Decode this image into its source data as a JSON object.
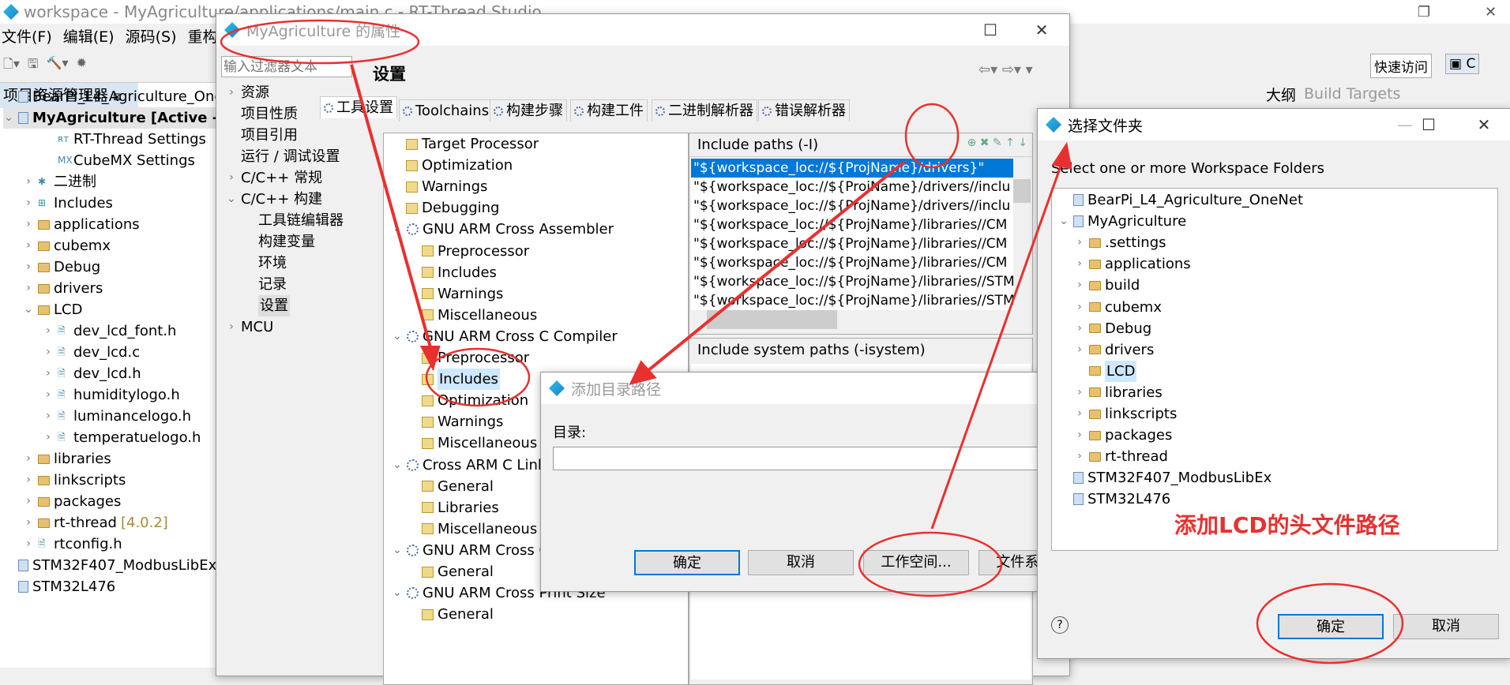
{
  "main_window": {
    "title": "workspace - MyAgriculture/applications/main.c - RT-Thread Studio",
    "menu": [
      "文件(F)",
      "编辑(E)",
      "源码(S)",
      "重构(T)"
    ],
    "quick_access": "快速访问",
    "explorer_tab": "项目资源管理器",
    "outline_tab": "大纲",
    "build_targets_tab": "Build Targets",
    "explorer_items": [
      {
        "label": "BearPi_L4_Agriculture_OneNet",
        "indent": 0,
        "icon": "project",
        "chev": ""
      },
      {
        "label": "MyAgriculture     [Active - ",
        "indent": 0,
        "icon": "project",
        "chev": "v",
        "bold": true
      },
      {
        "label": "RT-Thread Settings",
        "indent": 2,
        "icon": "rt",
        "chev": ""
      },
      {
        "label": "CubeMX Settings",
        "indent": 2,
        "icon": "mx",
        "chev": ""
      },
      {
        "label": "二进制",
        "indent": 1,
        "icon": "binary",
        "chev": ">"
      },
      {
        "label": "Includes",
        "indent": 1,
        "icon": "includes",
        "chev": ">"
      },
      {
        "label": "applications",
        "indent": 1,
        "icon": "folder",
        "chev": ">"
      },
      {
        "label": "cubemx",
        "indent": 1,
        "icon": "folder",
        "chev": ">"
      },
      {
        "label": "Debug",
        "indent": 1,
        "icon": "folder",
        "chev": ">"
      },
      {
        "label": "drivers",
        "indent": 1,
        "icon": "folder",
        "chev": ">"
      },
      {
        "label": "LCD",
        "indent": 1,
        "icon": "folder",
        "chev": "v"
      },
      {
        "label": "dev_lcd_font.h",
        "indent": 2,
        "icon": "file",
        "chev": ">"
      },
      {
        "label": "dev_lcd.c",
        "indent": 2,
        "icon": "file",
        "chev": ">"
      },
      {
        "label": "dev_lcd.h",
        "indent": 2,
        "icon": "file",
        "chev": ">"
      },
      {
        "label": "humiditylogo.h",
        "indent": 2,
        "icon": "file",
        "chev": ">"
      },
      {
        "label": "luminancelogo.h",
        "indent": 2,
        "icon": "file",
        "chev": ">"
      },
      {
        "label": "temperatuelogo.h",
        "indent": 2,
        "icon": "file",
        "chev": ">"
      },
      {
        "label": "libraries",
        "indent": 1,
        "icon": "folder",
        "chev": ">"
      },
      {
        "label": "linkscripts",
        "indent": 1,
        "icon": "folder",
        "chev": ">"
      },
      {
        "label": "packages",
        "indent": 1,
        "icon": "folder",
        "chev": ">"
      },
      {
        "label": "rt-thread",
        "indent": 1,
        "icon": "folder",
        "chev": ">",
        "suffix": "[4.0.2]"
      },
      {
        "label": "rtconfig.h",
        "indent": 1,
        "icon": "file",
        "chev": ">"
      },
      {
        "label": "STM32F407_ModbusLibEx",
        "indent": 0,
        "icon": "project",
        "chev": ""
      },
      {
        "label": "STM32L476",
        "indent": 0,
        "icon": "project",
        "chev": ""
      }
    ]
  },
  "properties_dialog": {
    "title": "MyAgriculture 的属性",
    "filter_placeholder": "输入过滤器文本",
    "heading": "设置",
    "nav": [
      {
        "label": "资源",
        "indent": 0,
        "chev": ">"
      },
      {
        "label": "项目性质",
        "indent": 0,
        "chev": ""
      },
      {
        "label": "项目引用",
        "indent": 0,
        "chev": ""
      },
      {
        "label": "运行 / 调试设置",
        "indent": 0,
        "chev": ""
      },
      {
        "label": "C/C++ 常规",
        "indent": 0,
        "chev": ">"
      },
      {
        "label": "C/C++ 构建",
        "indent": 0,
        "chev": "v"
      },
      {
        "label": "工具链编辑器",
        "indent": 1,
        "chev": ""
      },
      {
        "label": "构建变量",
        "indent": 1,
        "chev": ""
      },
      {
        "label": "环境",
        "indent": 1,
        "chev": ""
      },
      {
        "label": "记录",
        "indent": 1,
        "chev": ""
      },
      {
        "label": "设置",
        "indent": 1,
        "chev": "",
        "selected": true
      },
      {
        "label": "MCU",
        "indent": 0,
        "chev": ">"
      }
    ],
    "tabs": [
      "工具设置",
      "Toolchains",
      "构建步骤",
      "构建工件",
      "二进制解析器",
      "错误解析器"
    ],
    "tool_tree": [
      {
        "label": "Target Processor",
        "indent": 1,
        "icon": "tool"
      },
      {
        "label": "Optimization",
        "indent": 1,
        "icon": "tool"
      },
      {
        "label": "Warnings",
        "indent": 1,
        "icon": "tool"
      },
      {
        "label": "Debugging",
        "indent": 1,
        "icon": "tool"
      },
      {
        "label": "GNU ARM Cross Assembler",
        "indent": 0,
        "icon": "gear"
      },
      {
        "label": "Preprocessor",
        "indent": 2,
        "icon": "tool"
      },
      {
        "label": "Includes",
        "indent": 2,
        "icon": "tool"
      },
      {
        "label": "Warnings",
        "indent": 2,
        "icon": "tool"
      },
      {
        "label": "Miscellaneous",
        "indent": 2,
        "icon": "tool"
      },
      {
        "label": "GNU ARM Cross C Compiler",
        "indent": 0,
        "icon": "gear"
      },
      {
        "label": "Preprocessor",
        "indent": 2,
        "icon": "tool"
      },
      {
        "label": "Includes",
        "indent": 2,
        "icon": "tool",
        "selected": true
      },
      {
        "label": "Optimization",
        "indent": 2,
        "icon": "tool"
      },
      {
        "label": "Warnings",
        "indent": 2,
        "icon": "tool"
      },
      {
        "label": "Miscellaneous",
        "indent": 2,
        "icon": "tool"
      },
      {
        "label": "Cross ARM C Linker",
        "indent": 0,
        "icon": "gear"
      },
      {
        "label": "General",
        "indent": 2,
        "icon": "tool"
      },
      {
        "label": "Libraries",
        "indent": 2,
        "icon": "tool"
      },
      {
        "label": "Miscellaneous",
        "indent": 2,
        "icon": "tool"
      },
      {
        "label": "GNU ARM Cross Create Flash Image",
        "indent": 0,
        "icon": "gear"
      },
      {
        "label": "General",
        "indent": 2,
        "icon": "tool"
      },
      {
        "label": "GNU ARM Cross Print Size",
        "indent": 0,
        "icon": "gear"
      },
      {
        "label": "General",
        "indent": 2,
        "icon": "tool"
      }
    ],
    "include_paths_label": "Include paths (-I)",
    "include_paths": [
      "\"${workspace_loc://${ProjName}/drivers}\"",
      "\"${workspace_loc://${ProjName}/drivers//inclu",
      "\"${workspace_loc://${ProjName}/drivers//inclu",
      "\"${workspace_loc://${ProjName}/libraries//CM",
      "\"${workspace_loc://${ProjName}/libraries//CM",
      "\"${workspace_loc://${ProjName}/libraries//CM",
      "\"${workspace_loc://${ProjName}/libraries//STM",
      "\"${workspace_loc://${ProjName}/libraries//STM"
    ],
    "include_system_paths_label": "Include system paths (-isystem)"
  },
  "add_dir_dialog": {
    "title": "添加目录路径",
    "dir_label": "目录:",
    "dir_value": "",
    "ok": "确定",
    "cancel": "取消",
    "workspace": "工作空间...",
    "filesystem": "文件系统..."
  },
  "folder_dialog": {
    "title": "选择文件夹",
    "prompt": "Select one or more Workspace Folders",
    "tree": [
      {
        "label": "BearPi_L4_Agriculture_OneNet",
        "indent": 0,
        "icon": "project",
        "chev": ""
      },
      {
        "label": "MyAgriculture",
        "indent": 0,
        "icon": "project",
        "chev": "v"
      },
      {
        "label": ".settings",
        "indent": 1,
        "icon": "folder",
        "chev": ">"
      },
      {
        "label": "applications",
        "indent": 1,
        "icon": "folder",
        "chev": ">"
      },
      {
        "label": "build",
        "indent": 1,
        "icon": "folder",
        "chev": ">"
      },
      {
        "label": "cubemx",
        "indent": 1,
        "icon": "folder",
        "chev": ">"
      },
      {
        "label": "Debug",
        "indent": 1,
        "icon": "folder",
        "chev": ">"
      },
      {
        "label": "drivers",
        "indent": 1,
        "icon": "folder",
        "chev": ">"
      },
      {
        "label": "LCD",
        "indent": 1,
        "icon": "folder",
        "chev": "",
        "selected": true
      },
      {
        "label": "libraries",
        "indent": 1,
        "icon": "folder",
        "chev": ">"
      },
      {
        "label": "linkscripts",
        "indent": 1,
        "icon": "folder",
        "chev": ">"
      },
      {
        "label": "packages",
        "indent": 1,
        "icon": "folder",
        "chev": ">"
      },
      {
        "label": "rt-thread",
        "indent": 1,
        "icon": "folder",
        "chev": ">"
      },
      {
        "label": "STM32F407_ModbusLibEx",
        "indent": 0,
        "icon": "project",
        "chev": ""
      },
      {
        "label": "STM32L476",
        "indent": 0,
        "icon": "project",
        "chev": ""
      }
    ],
    "ok": "确定",
    "cancel": "取消"
  },
  "annotation": {
    "text": "添加LCD的头文件路径",
    "color": "#e8312f"
  }
}
